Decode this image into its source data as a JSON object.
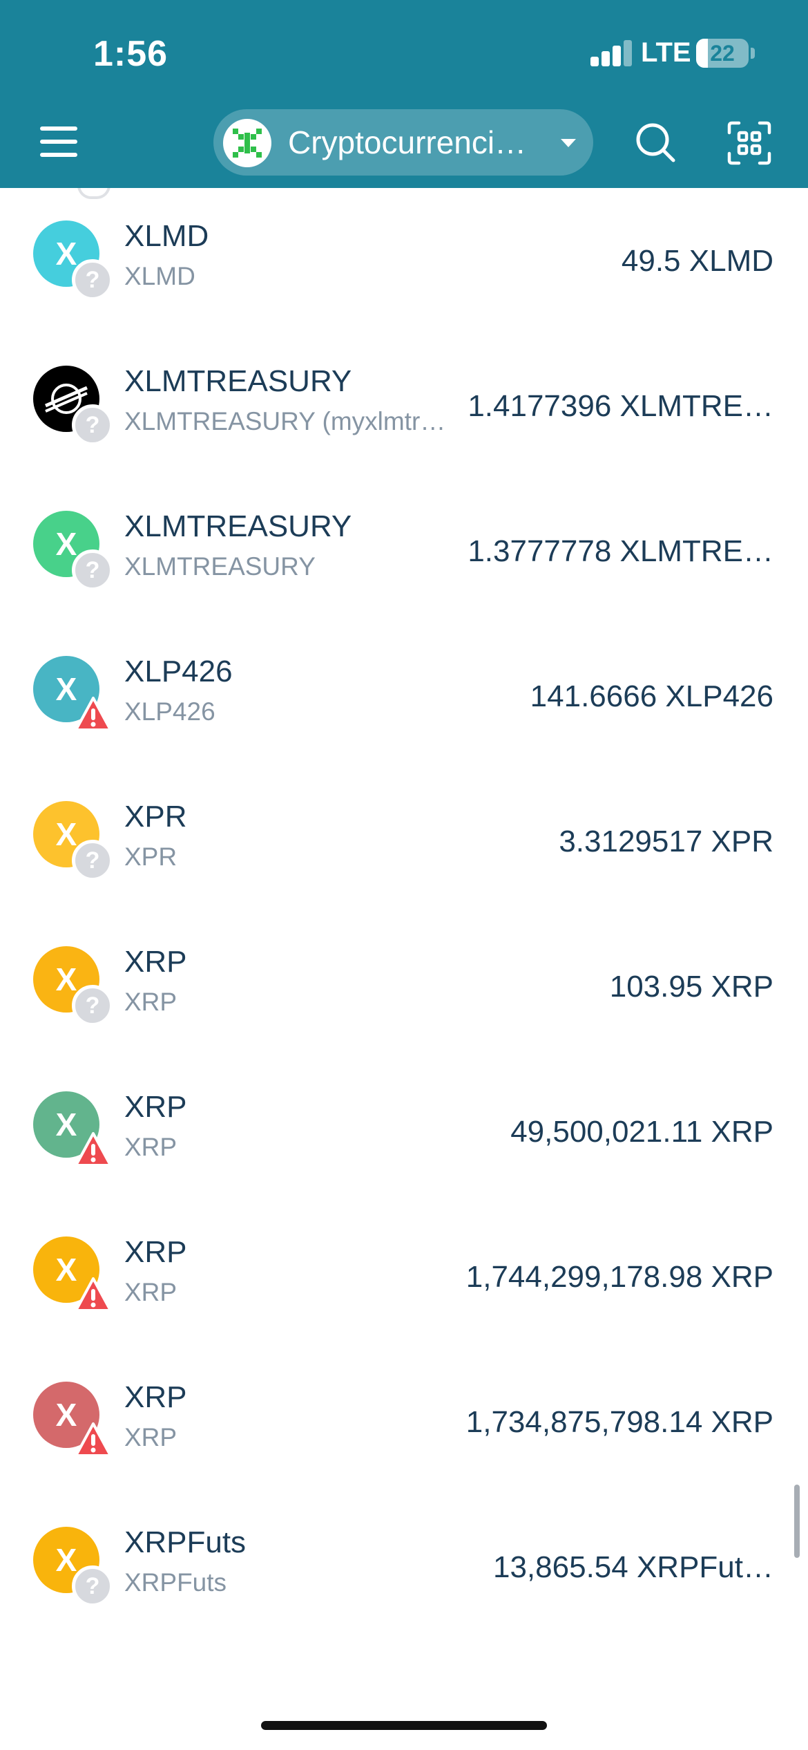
{
  "status_bar": {
    "time": "1:56",
    "network": "LTE",
    "battery": "22"
  },
  "header": {
    "network_name": "Cryptocurrenci…",
    "network_name_full": "Cryptocurrencies"
  },
  "colors": {
    "header_bg": "#1a839a",
    "primary_text": "#1c3c57",
    "secondary_text": "#8594a3",
    "warning": "#ee4a4f"
  },
  "tokens": [
    {
      "symbol": "XLMD",
      "name": "XLMD",
      "balance": "49.5 XLMD",
      "avatar_letter": "X",
      "avatar_color": "#45cedd",
      "badge": "?",
      "badge_type": "unknown"
    },
    {
      "symbol": "XLMTREASURY",
      "name": "XLMTREASURY (myxlmtr…",
      "balance": "1.4177396 XLMTRE…",
      "avatar_letter": "",
      "avatar_color": "#000000",
      "avatar_icon": "stellar-logo",
      "badge": "?",
      "badge_type": "unknown"
    },
    {
      "symbol": "XLMTREASURY",
      "name": "XLMTREASURY",
      "balance": "1.3777778 XLMTRE…",
      "avatar_letter": "X",
      "avatar_color": "#48d18a",
      "badge": "?",
      "badge_type": "unknown"
    },
    {
      "symbol": "XLP426",
      "name": "XLP426",
      "balance": "141.6666 XLP426",
      "avatar_letter": "X",
      "avatar_color": "#48b5c4",
      "badge": "!",
      "badge_type": "warning"
    },
    {
      "symbol": "XPR",
      "name": "XPR",
      "balance": "3.3129517 XPR",
      "avatar_letter": "X",
      "avatar_color": "#fdc22d",
      "badge": "?",
      "badge_type": "unknown"
    },
    {
      "symbol": "XRP",
      "name": "XRP",
      "balance": "103.95 XRP",
      "avatar_letter": "X",
      "avatar_color": "#fab413",
      "badge": "?",
      "badge_type": "unknown"
    },
    {
      "symbol": "XRP",
      "name": "XRP",
      "balance": "49,500,021.11 XRP",
      "avatar_letter": "X",
      "avatar_color": "#62b48d",
      "badge": "!",
      "badge_type": "warning"
    },
    {
      "symbol": "XRP",
      "name": "XRP",
      "balance": "1,744,299,178.98 XRP",
      "avatar_letter": "X",
      "avatar_color": "#f9b40c",
      "badge": "!",
      "badge_type": "warning"
    },
    {
      "symbol": "XRP",
      "name": "XRP",
      "balance": "1,734,875,798.14 XRP",
      "avatar_letter": "X",
      "avatar_color": "#d4696b",
      "badge": "!",
      "badge_type": "warning"
    },
    {
      "symbol": "XRPFuts",
      "name": "XRPFuts",
      "balance": "13,865.54 XRPFut…",
      "avatar_letter": "X",
      "avatar_color": "#f9b40c",
      "badge": "?",
      "badge_type": "unknown"
    }
  ]
}
